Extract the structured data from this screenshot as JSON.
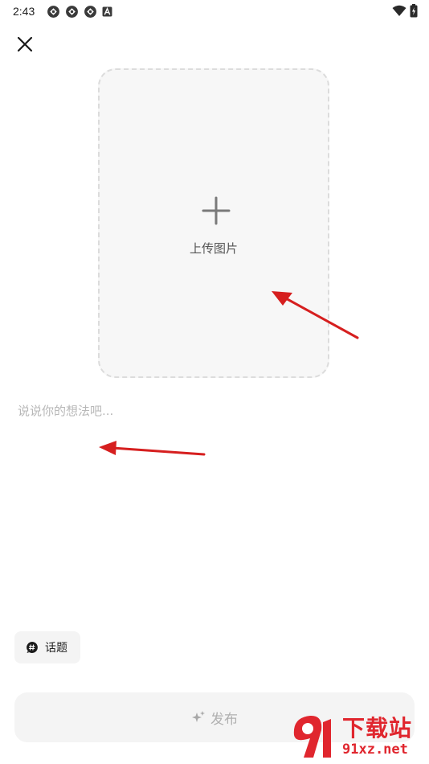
{
  "status_bar": {
    "time": "2:43",
    "left_icons": [
      "sync-icon",
      "sync-icon",
      "sync-icon",
      "app-a-icon"
    ],
    "right_icons": [
      "wifi-icon",
      "battery-icon"
    ]
  },
  "header": {
    "close_icon": "close-icon"
  },
  "upload": {
    "icon": "plus-icon",
    "label": "上传图片"
  },
  "post": {
    "placeholder": "说说你的想法吧...",
    "value": ""
  },
  "topic": {
    "icon": "hashtag-icon",
    "label": "话题"
  },
  "publish": {
    "icon": "sparkle-icon",
    "label": "发布"
  },
  "watermark": {
    "title": "下载站",
    "url": "91xz.net",
    "logo_text": "91"
  },
  "colors": {
    "annotation_arrow": "#d61f1f",
    "watermark": "#e0262e",
    "upload_bg": "#f7f7f7",
    "button_bg": "#f4f4f4"
  }
}
